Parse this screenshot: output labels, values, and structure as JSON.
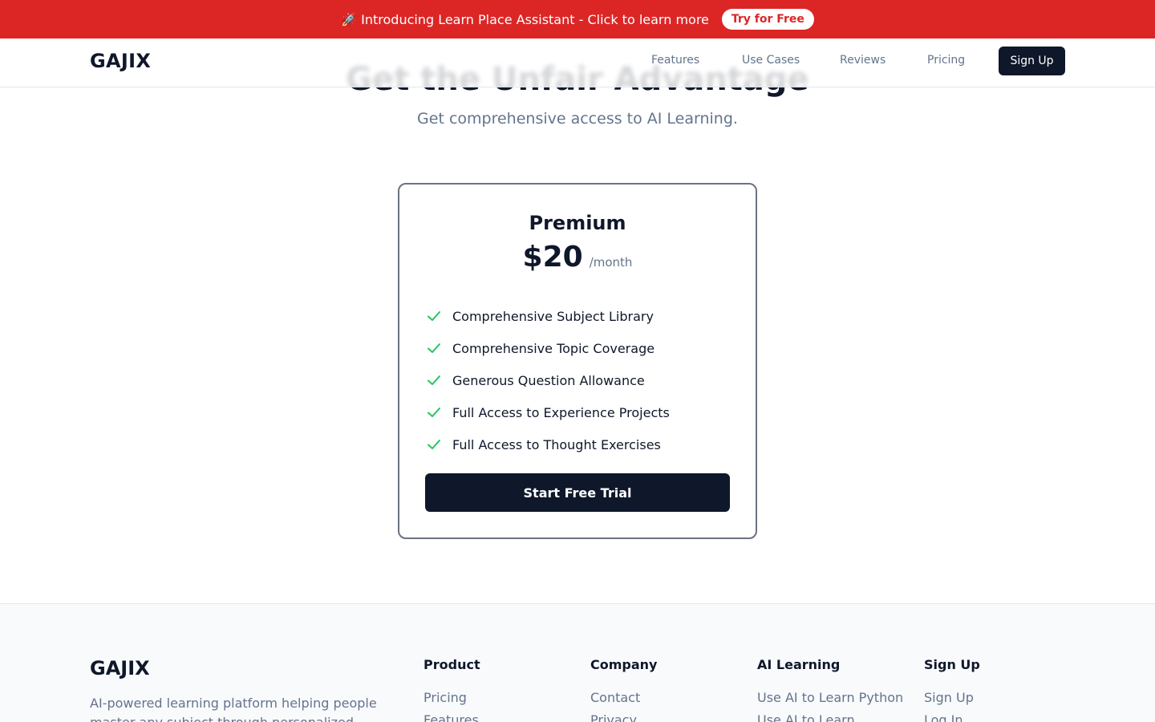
{
  "banner": {
    "icon": "rocket-icon",
    "text": "🚀 Introducing Learn Place Assistant - Click to learn more",
    "button_label": "Try for Free"
  },
  "nav": {
    "logo": "GAJIX",
    "links": [
      "Features",
      "Use Cases",
      "Reviews",
      "Pricing"
    ],
    "signup_label": "Sign Up"
  },
  "hero": {
    "heading": "Get the Unfair Advantage",
    "subheading": "Get comprehensive access to AI Learning."
  },
  "pricing_card": {
    "plan_name": "Premium",
    "price": "$20",
    "period": "/month",
    "check_icon": "check-icon",
    "features": [
      "Comprehensive Subject Library",
      "Comprehensive Topic Coverage",
      "Generous Question Allowance",
      "Full Access to Experience Projects",
      "Full Access to Thought Exercises"
    ],
    "cta_label": "Start Free Trial"
  },
  "footer": {
    "logo": "GAJIX",
    "description": "AI-powered learning platform helping people master any subject through personalized tutoring",
    "columns": [
      {
        "title": "Product",
        "links": [
          "Pricing",
          "Features"
        ]
      },
      {
        "title": "Company",
        "links": [
          "Contact",
          "Privacy"
        ]
      },
      {
        "title": "AI Learning",
        "links": [
          "Use AI to Learn Python",
          "Use AI to Learn"
        ]
      },
      {
        "title": "Sign Up",
        "links": [
          "Sign Up",
          "Log In"
        ]
      }
    ]
  },
  "colors": {
    "banner_red": "#dc2626",
    "navy": "#0f172a",
    "check_green": "#22c55e",
    "muted_text": "#64748b"
  }
}
